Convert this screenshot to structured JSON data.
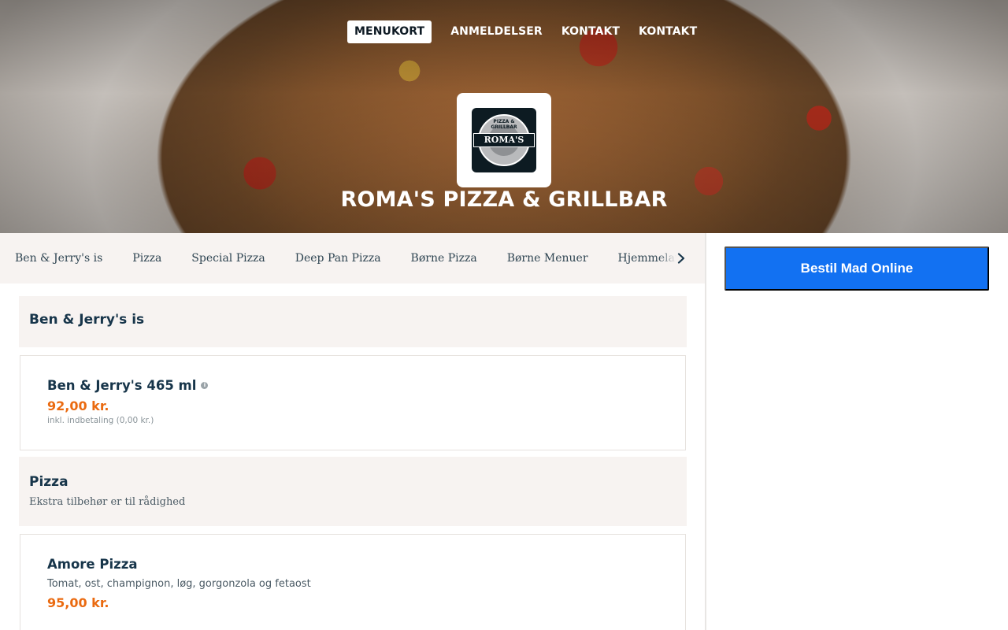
{
  "nav": {
    "items": [
      {
        "label": "MENUKORT",
        "active": true
      },
      {
        "label": "ANMELDELSER",
        "active": false
      },
      {
        "label": "KONTAKT",
        "active": false
      },
      {
        "label": "KONTAKT",
        "active": false
      }
    ]
  },
  "restaurant": {
    "name": "ROMA'S PIZZA & GRILLBAR",
    "logo": {
      "text": "ROMA'S",
      "arc": "PIZZA & GRILLBAR"
    }
  },
  "categories": [
    "Ben & Jerry's is",
    "Pizza",
    "Special Pizza",
    "Deep Pan Pizza",
    "Børne Pizza",
    "Børne Menuer",
    "Hjemmelavet"
  ],
  "sidebar": {
    "order_button": "Bestil Mad Online"
  },
  "menu": {
    "sections": [
      {
        "title": "Ben & Jerry's is",
        "description": "",
        "items": [
          {
            "name": "Ben & Jerry's 465 ml",
            "description": "",
            "price": "92,00 kr.",
            "deposit": "inkl. indbetaling (0,00 kr.)"
          }
        ]
      },
      {
        "title": "Pizza",
        "description": "Ekstra tilbehør er til rådighed",
        "items": [
          {
            "name": "Amore Pizza",
            "description": "Tomat, ost, champignon, løg, gorgonzola og fetaost",
            "price": "95,00 kr.",
            "deposit": ""
          }
        ]
      }
    ]
  },
  "colors": {
    "accent": "#1271f2",
    "price": "#ea6a10",
    "heading": "#17354a",
    "section_bg": "#f7f3f1"
  },
  "icons": {
    "info": "info-icon",
    "chevron": "chevron-right-icon"
  }
}
